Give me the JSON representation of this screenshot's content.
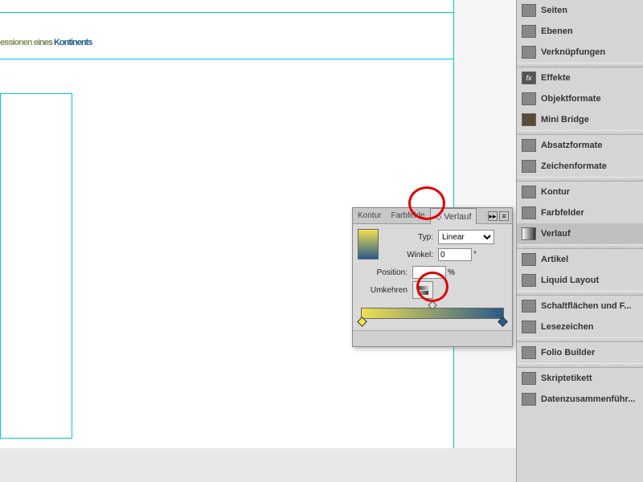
{
  "canvas": {
    "title_part1": "essionen eines ",
    "title_part2": "Kontinents"
  },
  "dock": {
    "items": [
      {
        "label": "Seiten"
      },
      {
        "label": "Ebenen"
      },
      {
        "label": "Verknüpfungen"
      },
      {
        "label": "Effekte"
      },
      {
        "label": "Objektformate"
      },
      {
        "label": "Mini Bridge"
      },
      {
        "label": "Absatzformate"
      },
      {
        "label": "Zeichenformate"
      },
      {
        "label": "Kontur"
      },
      {
        "label": "Farbfelder"
      },
      {
        "label": "Verlauf"
      },
      {
        "label": "Artikel"
      },
      {
        "label": "Liquid Layout"
      },
      {
        "label": "Schaltflächen und F..."
      },
      {
        "label": "Lesezeichen"
      },
      {
        "label": "Folio Builder"
      },
      {
        "label": "Skriptetikett"
      },
      {
        "label": "Datenzusammenführ..."
      }
    ]
  },
  "gradient_panel": {
    "tabs": {
      "kontur": "Kontur",
      "farbfelder": "Farbfelde",
      "verlauf": "Verlauf"
    },
    "type_label": "Typ:",
    "type_value": "Linear",
    "angle_label": "Winkel:",
    "angle_value": "0",
    "angle_unit": "°",
    "position_label": "Position:",
    "position_value": "",
    "position_unit": "%",
    "reverse_label": "Umkehren"
  }
}
